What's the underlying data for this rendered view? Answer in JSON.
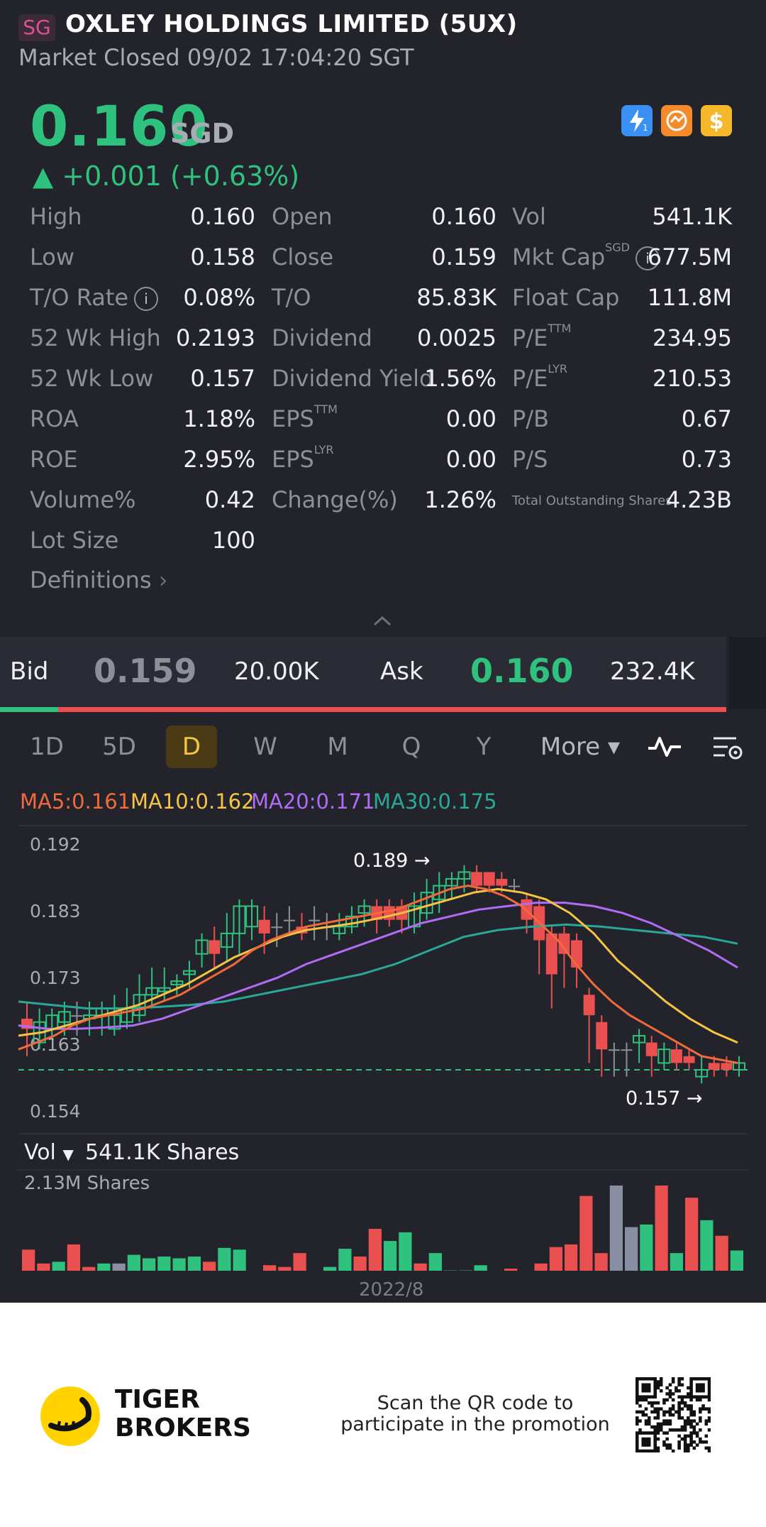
{
  "header": {
    "exchange_badge": "SG",
    "title": "OXLEY HOLDINGS LIMITED (5UX)",
    "status": "Market Closed 09/02 17:04:20 SGT"
  },
  "quote": {
    "price": "0.160",
    "currency": "SGD",
    "change": "▲ +0.001 (+0.63%)",
    "icons": [
      "lightning-icon",
      "exchange-icon",
      "dollar-icon"
    ]
  },
  "stats": [
    [
      {
        "label": "High",
        "value": "0.160"
      },
      {
        "label": "Open",
        "value": "0.160"
      },
      {
        "label": "Vol",
        "value": "541.1K"
      }
    ],
    [
      {
        "label": "Low",
        "value": "0.158"
      },
      {
        "label": "Close",
        "value": "0.159"
      },
      {
        "label": "Mkt Cap",
        "sup": "SGD",
        "value": "677.5M"
      }
    ],
    [
      {
        "label": "T/O Rate",
        "value": "0.08%"
      },
      {
        "label": "T/O",
        "value": "85.83K"
      },
      {
        "label": "Float Cap",
        "value": "111.8M"
      }
    ],
    [
      {
        "label": "52 Wk High",
        "value": "0.2193"
      },
      {
        "label": "Dividend",
        "value": "0.0025"
      },
      {
        "label": "P/E",
        "sup": "TTM",
        "value": "234.95"
      }
    ],
    [
      {
        "label": "52 Wk Low",
        "value": "0.157"
      },
      {
        "label": "Dividend Yield",
        "value": "1.56%"
      },
      {
        "label": "P/E",
        "sup": "LYR",
        "value": "210.53"
      }
    ],
    [
      {
        "label": "ROA",
        "value": "1.18%"
      },
      {
        "label": "EPS",
        "sup": "TTM",
        "value": "0.00"
      },
      {
        "label": "P/B",
        "value": "0.67"
      }
    ],
    [
      {
        "label": "ROE",
        "value": "2.95%"
      },
      {
        "label": "EPS",
        "sup": "LYR",
        "value": "0.00"
      },
      {
        "label": "P/S",
        "value": "0.73"
      }
    ],
    [
      {
        "label": "Volume%",
        "value": "0.42"
      },
      {
        "label": "Change(%)",
        "value": "1.26%"
      },
      {
        "label": "Total Outstanding Shares",
        "value": "4.23B"
      }
    ],
    [
      {
        "label": "Lot Size",
        "value": "100"
      }
    ]
  ],
  "definitions_label": "Definitions",
  "orderbook": {
    "bid_label": "Bid",
    "bid_price": "0.159",
    "bid_size": "20.00K",
    "ask_label": "Ask",
    "ask_price": "0.160",
    "ask_size": "232.4K",
    "bid_ratio": 0.08
  },
  "tabs": [
    "1D",
    "5D",
    "D",
    "W",
    "M",
    "Q",
    "Y",
    "More"
  ],
  "active_tab": "D",
  "ma": {
    "ma5": "MA5:0.161",
    "ma10": "MA10:0.162",
    "ma20": "MA20:0.171",
    "ma30": "MA30:0.175",
    "colors": {
      "ma5": "#f26a3b",
      "ma10": "#f5c443",
      "ma20": "#b06cf5",
      "ma30": "#2aa897"
    }
  },
  "chart_data": {
    "type": "candlestick",
    "y_ticks": [
      "0.192",
      "0.183",
      "0.173",
      "0.163",
      "0.154"
    ],
    "ylim": [
      0.154,
      0.192
    ],
    "high_marker": "0.189",
    "low_marker": "0.157",
    "reference_line": 0.159,
    "x_label": "2022/8",
    "candles": [
      {
        "o": 0.1665,
        "c": 0.165,
        "h": 0.169,
        "l": 0.161
      },
      {
        "o": 0.163,
        "c": 0.166,
        "h": 0.168,
        "l": 0.162
      },
      {
        "o": 0.165,
        "c": 0.167,
        "h": 0.168,
        "l": 0.164
      },
      {
        "o": 0.166,
        "c": 0.1675,
        "h": 0.169,
        "l": 0.164
      },
      {
        "o": 0.167,
        "c": 0.167,
        "h": 0.169,
        "l": 0.164
      },
      {
        "o": 0.1665,
        "c": 0.167,
        "h": 0.169,
        "l": 0.164
      },
      {
        "o": 0.167,
        "c": 0.168,
        "h": 0.169,
        "l": 0.164
      },
      {
        "o": 0.165,
        "c": 0.167,
        "h": 0.17,
        "l": 0.164
      },
      {
        "o": 0.166,
        "c": 0.168,
        "h": 0.171,
        "l": 0.165
      },
      {
        "o": 0.167,
        "c": 0.17,
        "h": 0.173,
        "l": 0.166
      },
      {
        "o": 0.17,
        "c": 0.171,
        "h": 0.174,
        "l": 0.168
      },
      {
        "o": 0.1705,
        "c": 0.171,
        "h": 0.174,
        "l": 0.169
      },
      {
        "o": 0.1715,
        "c": 0.172,
        "h": 0.173,
        "l": 0.17
      },
      {
        "o": 0.173,
        "c": 0.1735,
        "h": 0.175,
        "l": 0.171
      },
      {
        "o": 0.176,
        "c": 0.178,
        "h": 0.179,
        "l": 0.174
      },
      {
        "o": 0.178,
        "c": 0.176,
        "h": 0.18,
        "l": 0.174
      },
      {
        "o": 0.177,
        "c": 0.179,
        "h": 0.182,
        "l": 0.175
      },
      {
        "o": 0.179,
        "c": 0.183,
        "h": 0.184,
        "l": 0.176
      },
      {
        "o": 0.18,
        "c": 0.183,
        "h": 0.184,
        "l": 0.178
      },
      {
        "o": 0.181,
        "c": 0.179,
        "h": 0.183,
        "l": 0.176
      },
      {
        "o": 0.18,
        "c": 0.18,
        "h": 0.182,
        "l": 0.177
      },
      {
        "o": 0.181,
        "c": 0.181,
        "h": 0.183,
        "l": 0.179
      },
      {
        "o": 0.18,
        "c": 0.179,
        "h": 0.182,
        "l": 0.178
      },
      {
        "o": 0.181,
        "c": 0.181,
        "h": 0.183,
        "l": 0.178
      },
      {
        "o": 0.18,
        "c": 0.18,
        "h": 0.182,
        "l": 0.178
      },
      {
        "o": 0.179,
        "c": 0.18,
        "h": 0.182,
        "l": 0.178
      },
      {
        "o": 0.18,
        "c": 0.1815,
        "h": 0.183,
        "l": 0.179
      },
      {
        "o": 0.182,
        "c": 0.183,
        "h": 0.184,
        "l": 0.18
      },
      {
        "o": 0.183,
        "c": 0.181,
        "h": 0.184,
        "l": 0.179
      },
      {
        "o": 0.183,
        "c": 0.181,
        "h": 0.184,
        "l": 0.18
      },
      {
        "o": 0.183,
        "c": 0.181,
        "h": 0.184,
        "l": 0.179
      },
      {
        "o": 0.18,
        "c": 0.183,
        "h": 0.185,
        "l": 0.179
      },
      {
        "o": 0.182,
        "c": 0.185,
        "h": 0.187,
        "l": 0.181
      },
      {
        "o": 0.184,
        "c": 0.186,
        "h": 0.188,
        "l": 0.182
      },
      {
        "o": 0.186,
        "c": 0.187,
        "h": 0.188,
        "l": 0.184
      },
      {
        "o": 0.187,
        "c": 0.188,
        "h": 0.189,
        "l": 0.185
      },
      {
        "o": 0.188,
        "c": 0.186,
        "h": 0.189,
        "l": 0.185
      },
      {
        "o": 0.188,
        "c": 0.186,
        "h": 0.188,
        "l": 0.185
      },
      {
        "o": 0.187,
        "c": 0.186,
        "h": 0.188,
        "l": 0.185
      },
      {
        "o": 0.186,
        "c": 0.186,
        "h": 0.187,
        "l": 0.185
      },
      {
        "o": 0.184,
        "c": 0.181,
        "h": 0.185,
        "l": 0.179
      },
      {
        "o": 0.183,
        "c": 0.178,
        "h": 0.184,
        "l": 0.173
      },
      {
        "o": 0.179,
        "c": 0.173,
        "h": 0.18,
        "l": 0.168
      },
      {
        "o": 0.179,
        "c": 0.176,
        "h": 0.18,
        "l": 0.171
      },
      {
        "o": 0.178,
        "c": 0.174,
        "h": 0.179,
        "l": 0.171
      },
      {
        "o": 0.17,
        "c": 0.167,
        "h": 0.171,
        "l": 0.16
      },
      {
        "o": 0.166,
        "c": 0.162,
        "h": 0.167,
        "l": 0.158
      },
      {
        "o": 0.162,
        "c": 0.162,
        "h": 0.163,
        "l": 0.158
      },
      {
        "o": 0.162,
        "c": 0.162,
        "h": 0.163,
        "l": 0.158
      },
      {
        "o": 0.163,
        "c": 0.164,
        "h": 0.165,
        "l": 0.16
      },
      {
        "o": 0.163,
        "c": 0.161,
        "h": 0.164,
        "l": 0.158
      },
      {
        "o": 0.16,
        "c": 0.162,
        "h": 0.163,
        "l": 0.159
      },
      {
        "o": 0.162,
        "c": 0.16,
        "h": 0.163,
        "l": 0.159
      },
      {
        "o": 0.161,
        "c": 0.16,
        "h": 0.162,
        "l": 0.159
      },
      {
        "o": 0.158,
        "c": 0.159,
        "h": 0.161,
        "l": 0.157
      },
      {
        "o": 0.16,
        "c": 0.159,
        "h": 0.161,
        "l": 0.158
      },
      {
        "o": 0.16,
        "c": 0.159,
        "h": 0.161,
        "l": 0.158
      },
      {
        "o": 0.159,
        "c": 0.16,
        "h": 0.161,
        "l": 0.158
      }
    ],
    "ma_lines": {
      "ma5": [
        0.162,
        0.163,
        0.164,
        0.1655,
        0.1665,
        0.167,
        0.1675,
        0.168,
        0.169,
        0.17,
        0.1715,
        0.173,
        0.1745,
        0.1765,
        0.178,
        0.179,
        0.18,
        0.1805,
        0.181,
        0.1815,
        0.182,
        0.1825,
        0.1835,
        0.1845,
        0.1855,
        0.186,
        0.1855,
        0.1845,
        0.183,
        0.1805,
        0.178,
        0.1745,
        0.1715,
        0.169,
        0.167,
        0.1655,
        0.164,
        0.1625,
        0.161,
        0.1605,
        0.16
      ],
      "ma10": [
        0.164,
        0.1645,
        0.1655,
        0.1665,
        0.1675,
        0.1685,
        0.17,
        0.1715,
        0.1735,
        0.1755,
        0.177,
        0.1785,
        0.1795,
        0.18,
        0.1805,
        0.1812,
        0.182,
        0.183,
        0.184,
        0.185,
        0.1855,
        0.185,
        0.184,
        0.182,
        0.179,
        0.175,
        0.172,
        0.169,
        0.1665,
        0.1645,
        0.163
      ],
      "ma20": [
        0.1655,
        0.165,
        0.165,
        0.1652,
        0.1655,
        0.1665,
        0.168,
        0.1695,
        0.171,
        0.1725,
        0.1745,
        0.176,
        0.1775,
        0.179,
        0.1805,
        0.1815,
        0.1825,
        0.183,
        0.1835,
        0.1835,
        0.183,
        0.182,
        0.1805,
        0.1785,
        0.1765,
        0.174
      ],
      "ma30": [
        0.169,
        0.1685,
        0.168,
        0.168,
        0.1682,
        0.1685,
        0.169,
        0.17,
        0.171,
        0.172,
        0.173,
        0.1745,
        0.1765,
        0.1785,
        0.1795,
        0.18,
        0.1803,
        0.18,
        0.1795,
        0.179,
        0.1785,
        0.1775
      ]
    }
  },
  "volume": {
    "label": "Vol",
    "current": "541.1K Shares",
    "max_label": "2.13M Shares",
    "bars": [
      {
        "v": 0.26,
        "c": "red"
      },
      {
        "v": 0.1,
        "c": "red"
      },
      {
        "v": 0.12,
        "c": "green"
      },
      {
        "v": 0.32,
        "c": "red"
      },
      {
        "v": 0.06,
        "c": "red"
      },
      {
        "v": 0.1,
        "c": "green"
      },
      {
        "v": 0.1,
        "c": "gray"
      },
      {
        "v": 0.2,
        "c": "green"
      },
      {
        "v": 0.16,
        "c": "green"
      },
      {
        "v": 0.18,
        "c": "green"
      },
      {
        "v": 0.16,
        "c": "green"
      },
      {
        "v": 0.18,
        "c": "green"
      },
      {
        "v": 0.12,
        "c": "red"
      },
      {
        "v": 0.28,
        "c": "green"
      },
      {
        "v": 0.26,
        "c": "green"
      },
      {
        "v": 0.01,
        "c": "green"
      },
      {
        "v": 0.08,
        "c": "red"
      },
      {
        "v": 0.06,
        "c": "red"
      },
      {
        "v": 0.22,
        "c": "red"
      },
      {
        "v": 0.0,
        "c": "green"
      },
      {
        "v": 0.06,
        "c": "green"
      },
      {
        "v": 0.27,
        "c": "green"
      },
      {
        "v": 0.18,
        "c": "red"
      },
      {
        "v": 0.5,
        "c": "red"
      },
      {
        "v": 0.36,
        "c": "green"
      },
      {
        "v": 0.46,
        "c": "green"
      },
      {
        "v": 0.1,
        "c": "red"
      },
      {
        "v": 0.22,
        "c": "green"
      },
      {
        "v": 0.02,
        "c": "green"
      },
      {
        "v": 0.02,
        "c": "green"
      },
      {
        "v": 0.08,
        "c": "green"
      },
      {
        "v": 0.0,
        "c": "green"
      },
      {
        "v": 0.04,
        "c": "red"
      },
      {
        "v": 0.0,
        "c": "green"
      },
      {
        "v": 0.1,
        "c": "red"
      },
      {
        "v": 0.29,
        "c": "red"
      },
      {
        "v": 0.32,
        "c": "red"
      },
      {
        "v": 0.88,
        "c": "red"
      },
      {
        "v": 0.22,
        "c": "red"
      },
      {
        "v": 1.0,
        "c": "gray"
      },
      {
        "v": 0.52,
        "c": "gray"
      },
      {
        "v": 0.55,
        "c": "green"
      },
      {
        "v": 1.0,
        "c": "red"
      },
      {
        "v": 0.22,
        "c": "green"
      },
      {
        "v": 0.86,
        "c": "red"
      },
      {
        "v": 0.6,
        "c": "green"
      },
      {
        "v": 0.42,
        "c": "red"
      },
      {
        "v": 0.25,
        "c": "green"
      }
    ]
  },
  "footer": {
    "brand_line1": "TIGER",
    "brand_line2": "BROKERS",
    "promo_line1": "Scan the QR code to",
    "promo_line2": "participate in the promotion"
  }
}
